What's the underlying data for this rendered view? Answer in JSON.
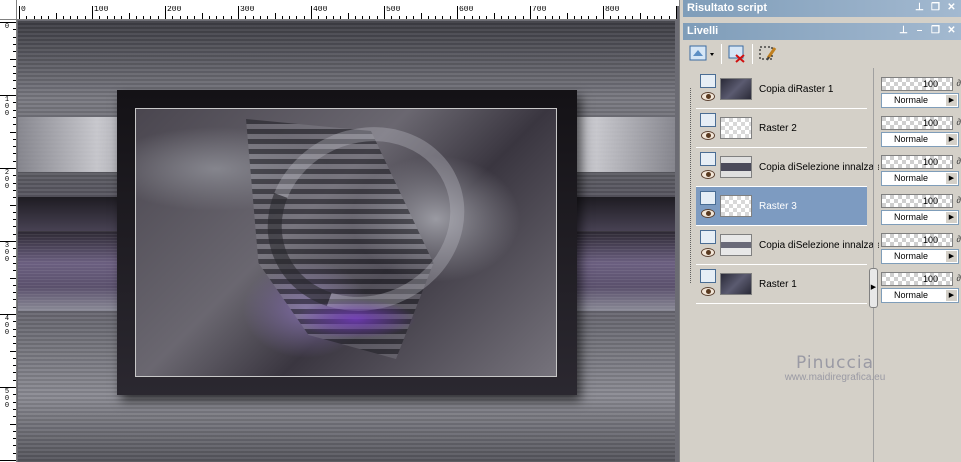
{
  "ruler": {
    "top_labels": [
      "0",
      "100",
      "200",
      "300",
      "400",
      "500",
      "600",
      "700",
      "800",
      "900"
    ],
    "left_labels": [
      "0",
      "100",
      "200",
      "300",
      "400",
      "500"
    ]
  },
  "panels": {
    "script_output_title": "Risultato script",
    "layers_title": "Livelli"
  },
  "layers": [
    {
      "name": "Copia diRaster 1",
      "opacity": "100",
      "blend": "Normale",
      "thumb": "dark",
      "selected": false
    },
    {
      "name": "Raster 2",
      "opacity": "100",
      "blend": "Normale",
      "thumb": "checker",
      "selected": false
    },
    {
      "name": "Copia diSelezione innalzata",
      "opacity": "100",
      "blend": "Normale",
      "thumb": "band",
      "selected": false
    },
    {
      "name": "Raster 3",
      "opacity": "100",
      "blend": "Normale",
      "thumb": "checker",
      "selected": true
    },
    {
      "name": "Copia diSelezione innalzata",
      "opacity": "100",
      "blend": "Normale",
      "thumb": "band2",
      "selected": false
    },
    {
      "name": "Raster 1",
      "opacity": "100",
      "blend": "Normale",
      "thumb": "dark",
      "selected": false
    }
  ],
  "watermark": {
    "name": "Pinuccia",
    "site": "www.maidiregrafica.eu"
  },
  "icons": {
    "new_layer": "new-layer-icon",
    "delete_layer": "delete-layer-icon",
    "edit_selection": "edit-selection-icon"
  },
  "colors": {
    "title_bar": "#7f9db9",
    "selected_row": "#7d9bc1",
    "panel_bg": "#d4d0c8"
  }
}
